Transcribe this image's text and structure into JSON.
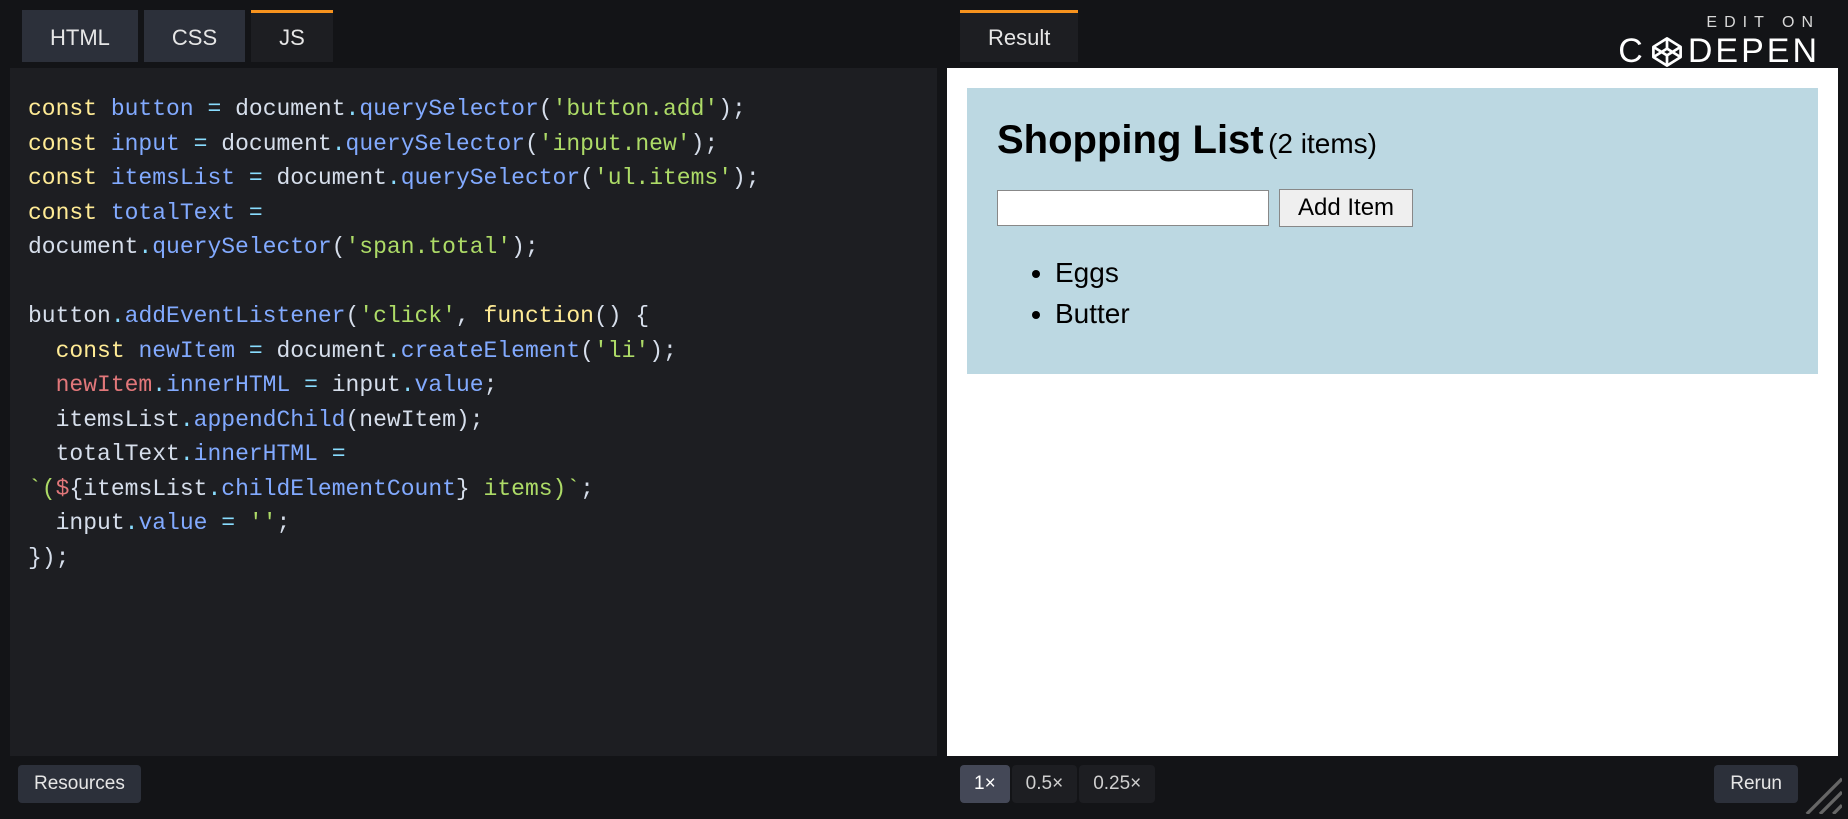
{
  "tabs": {
    "html": "HTML",
    "css": "CSS",
    "js": "JS",
    "result": "Result"
  },
  "branding": {
    "edit_on": "EDIT ON",
    "logo_text_left": "C",
    "logo_text_right": "DEPEN"
  },
  "code": {
    "line1_const": "const",
    "line1_var": "button",
    "line1_obj": "document",
    "line1_method": "querySelector",
    "line1_str": "'button.add'",
    "line2_const": "const",
    "line2_var": "input",
    "line2_obj": "document",
    "line2_method": "querySelector",
    "line2_str": "'input.new'",
    "line3_const": "const",
    "line3_var": "itemsList",
    "line3_obj": "document",
    "line3_method": "querySelector",
    "line3_str": "'ul.items'",
    "line4_const": "const",
    "line4_var": "totalText",
    "line5_obj": "document",
    "line5_method": "querySelector",
    "line5_str": "'span.total'",
    "line7_obj": "button",
    "line7_method": "addEventListener",
    "line7_str": "'click'",
    "line7_kw": "function",
    "line8_const": "const",
    "line8_var": "newItem",
    "line8_obj": "document",
    "line8_method": "createElement",
    "line8_str": "'li'",
    "line9_obj": "newItem",
    "line9_prop": "innerHTML",
    "line9_rhs_obj": "input",
    "line9_rhs_prop": "value",
    "line10_obj": "itemsList",
    "line10_method": "appendChild",
    "line10_arg": "newItem",
    "line11_obj": "totalText",
    "line11_prop": "innerHTML",
    "line12_tpl_open": "`(",
    "line12_dollar": "$",
    "line12_expr_obj": "itemsList",
    "line12_expr_prop": "childElementCount",
    "line12_tpl_close": " items)`",
    "line13_obj": "input",
    "line13_prop": "value",
    "line13_str": "''"
  },
  "result": {
    "title": "Shopping List",
    "count_text": "(2 items)",
    "add_button": "Add Item",
    "input_value": "",
    "items": [
      "Eggs",
      "Butter"
    ]
  },
  "bottom": {
    "resources": "Resources",
    "zoom1": "1×",
    "zoom05": "0.5×",
    "zoom025": "0.25×",
    "rerun": "Rerun"
  }
}
